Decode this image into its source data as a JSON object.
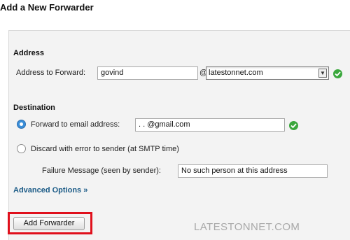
{
  "page": {
    "title": "Add a New Forwarder"
  },
  "address_section": {
    "title": "Address",
    "forward_label": "Address to Forward:",
    "forward_value": "govind",
    "at_symbol": "@",
    "domain_selected": "latestonnet.com"
  },
  "destination_section": {
    "title": "Destination",
    "forward_email_label": "Forward to email address:",
    "forward_email_value": ".                        . @gmail.com",
    "discard_label": "Discard with error to sender (at SMTP time)",
    "failure_label": "Failure Message (seen by sender):",
    "failure_value": "No such person at this address"
  },
  "advanced_link": "Advanced Options »",
  "submit_label": "Add Forwarder",
  "watermark": "LATESTONNET.COM",
  "colors": {
    "valid": "#3aa73c",
    "highlight": "#e0101c",
    "link": "#1a5a86"
  }
}
